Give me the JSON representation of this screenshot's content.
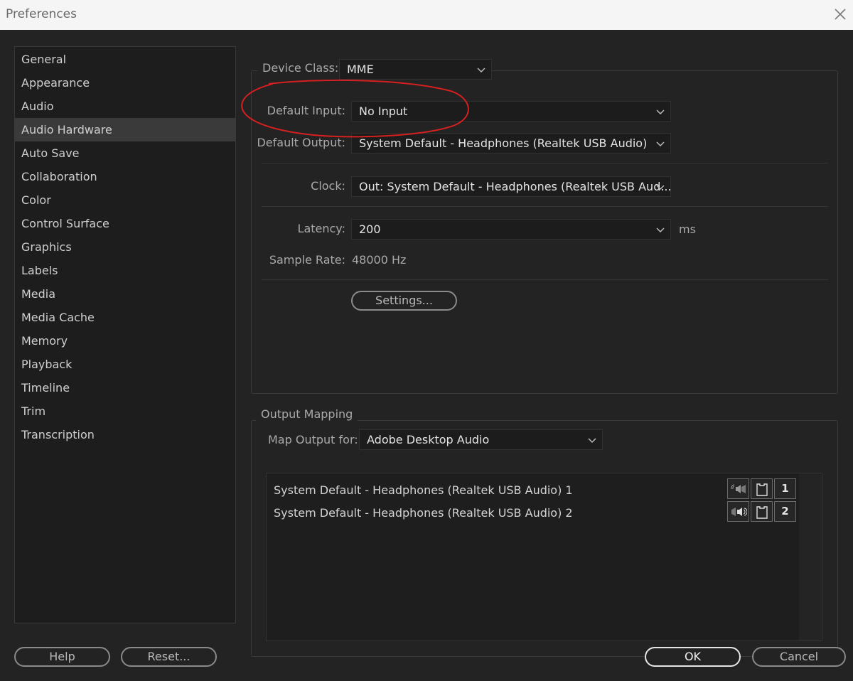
{
  "window": {
    "title": "Preferences"
  },
  "sidebar": {
    "items": [
      {
        "label": "General"
      },
      {
        "label": "Appearance"
      },
      {
        "label": "Audio"
      },
      {
        "label": "Audio Hardware",
        "selected": true
      },
      {
        "label": "Auto Save"
      },
      {
        "label": "Collaboration"
      },
      {
        "label": "Color"
      },
      {
        "label": "Control Surface"
      },
      {
        "label": "Graphics"
      },
      {
        "label": "Labels"
      },
      {
        "label": "Media"
      },
      {
        "label": "Media Cache"
      },
      {
        "label": "Memory"
      },
      {
        "label": "Playback"
      },
      {
        "label": "Timeline"
      },
      {
        "label": "Trim"
      },
      {
        "label": "Transcription"
      }
    ]
  },
  "audio_hardware": {
    "device_class_label": "Device Class:",
    "device_class_value": "MME",
    "default_input_label": "Default Input:",
    "default_input_value": "No Input",
    "default_output_label": "Default Output:",
    "default_output_value": "System Default - Headphones (Realtek USB Audio)",
    "clock_label": "Clock:",
    "clock_value": "Out: System Default - Headphones (Realtek USB Aud...",
    "latency_label": "Latency:",
    "latency_value": "200",
    "latency_unit": "ms",
    "sample_rate_label": "Sample Rate:",
    "sample_rate_value": "48000 Hz",
    "settings_button": "Settings..."
  },
  "output_mapping": {
    "group_label": "Output Mapping",
    "map_output_label": "Map Output for:",
    "map_output_value": "Adobe Desktop Audio",
    "channels": [
      {
        "name": "System Default - Headphones (Realtek USB Audio) 1",
        "index": "1",
        "icon": "speaker-left-icon"
      },
      {
        "name": "System Default - Headphones (Realtek USB Audio) 2",
        "index": "2",
        "icon": "speaker-right-icon"
      }
    ]
  },
  "footer": {
    "help": "Help",
    "reset": "Reset...",
    "ok": "OK",
    "cancel": "Cancel"
  },
  "colors": {
    "background": "#232323",
    "sidebar": "#1d1d1d",
    "selected": "#3a3a3a",
    "annotation": "#d42020"
  }
}
